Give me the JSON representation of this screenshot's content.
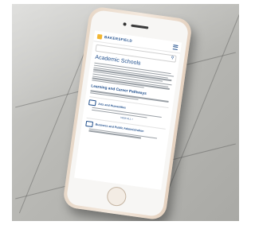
{
  "university_logo_text": "BAKERSFIELD",
  "page_title": "Academic Schools",
  "section_title": "Learning and Career Pathways",
  "cards": [
    {
      "label": "Arts and Humanities",
      "more": "VIEW ALL >"
    },
    {
      "label": "Business and Public Administration"
    }
  ],
  "colors": {
    "brand_blue": "#1f4e8c",
    "brand_gold": "#f2b632",
    "phone_gold": "#efe0d1"
  }
}
